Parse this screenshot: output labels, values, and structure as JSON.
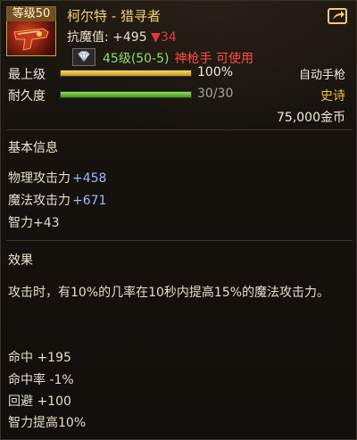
{
  "item": {
    "level_badge": "等级50",
    "name": "柯尔特 - 猎寻者",
    "resist_label": "抗魔值:",
    "resist_value": "+495",
    "resist_delta": "▼34",
    "gem": {
      "icon": "diamond-icon",
      "text": "45级(50-5)",
      "requirement": "神枪手 可使用"
    },
    "upgrade": {
      "label": "最上级",
      "percent_text": "100%",
      "fill_fraction": 1.0
    },
    "durability": {
      "label": "耐久度",
      "value_text": "30/30",
      "fill_fraction": 1.0
    },
    "weapon_type": "自动手枪",
    "rarity": "史诗",
    "price": "75,000金币"
  },
  "basic_info": {
    "title": "基本信息",
    "stats": [
      {
        "label": "物理攻击力",
        "value": "+458"
      },
      {
        "label": "魔法攻击力",
        "value": "+671"
      },
      {
        "label": "智力",
        "value": "+43"
      }
    ]
  },
  "effect": {
    "title": "效果",
    "description": "攻击时，有10%的几率在10秒内提高15%的魔法攻击力。",
    "stats": [
      "命中 +195",
      "命中率 -1%",
      "回避 +100",
      "智力提高10%"
    ]
  },
  "colors": {
    "title_gold": "#f3cd74",
    "rarity_epic": "#f2c03a",
    "stat_blue": "#9fb7ff",
    "gem_green": "#8ee06a",
    "warn_red": "#ff4b44",
    "resist_down": "#e0393a"
  },
  "icons": {
    "item": "pistol-item-icon",
    "share": "share-icon"
  }
}
